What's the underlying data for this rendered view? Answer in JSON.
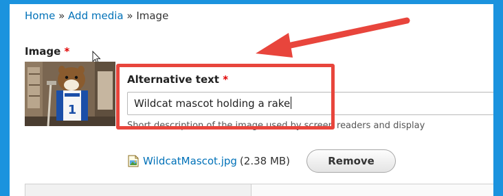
{
  "breadcrumb": {
    "home": "Home",
    "separator1": "»",
    "add_media": "Add media",
    "separator2": "»",
    "current": "Image"
  },
  "image_field": {
    "label": "Image",
    "required_marker": "*"
  },
  "alt_text": {
    "label": "Alternative text",
    "required_marker": "*",
    "value": "Wildcat mascot holding a rake",
    "description": "Short description of the image used by screen readers and display"
  },
  "file": {
    "name": "WildcatMascot.jpg",
    "size": "(2.38 MB)",
    "remove_label": "Remove",
    "icon": "image-file-icon"
  },
  "annotation": {
    "highlight_color": "#e8453c",
    "frame_color": "#1b93de"
  }
}
